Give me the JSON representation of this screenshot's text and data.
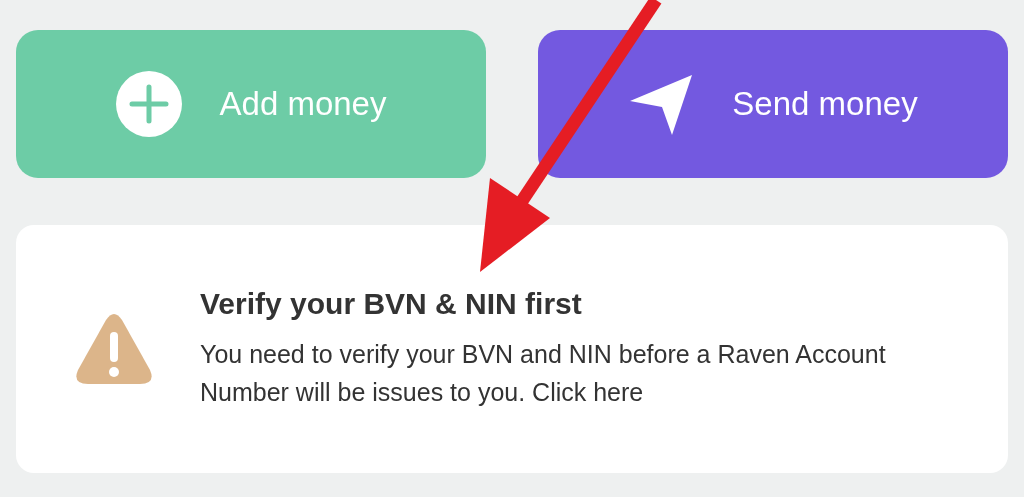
{
  "actions": [
    {
      "kind": "add",
      "label": "Add money"
    },
    {
      "kind": "send",
      "label": "Send money"
    }
  ],
  "notice": {
    "title": "Verify your BVN & NIN first",
    "body": "You need to verify your BVN and NIN before a Raven Account Number will be issues to you. Click here"
  }
}
